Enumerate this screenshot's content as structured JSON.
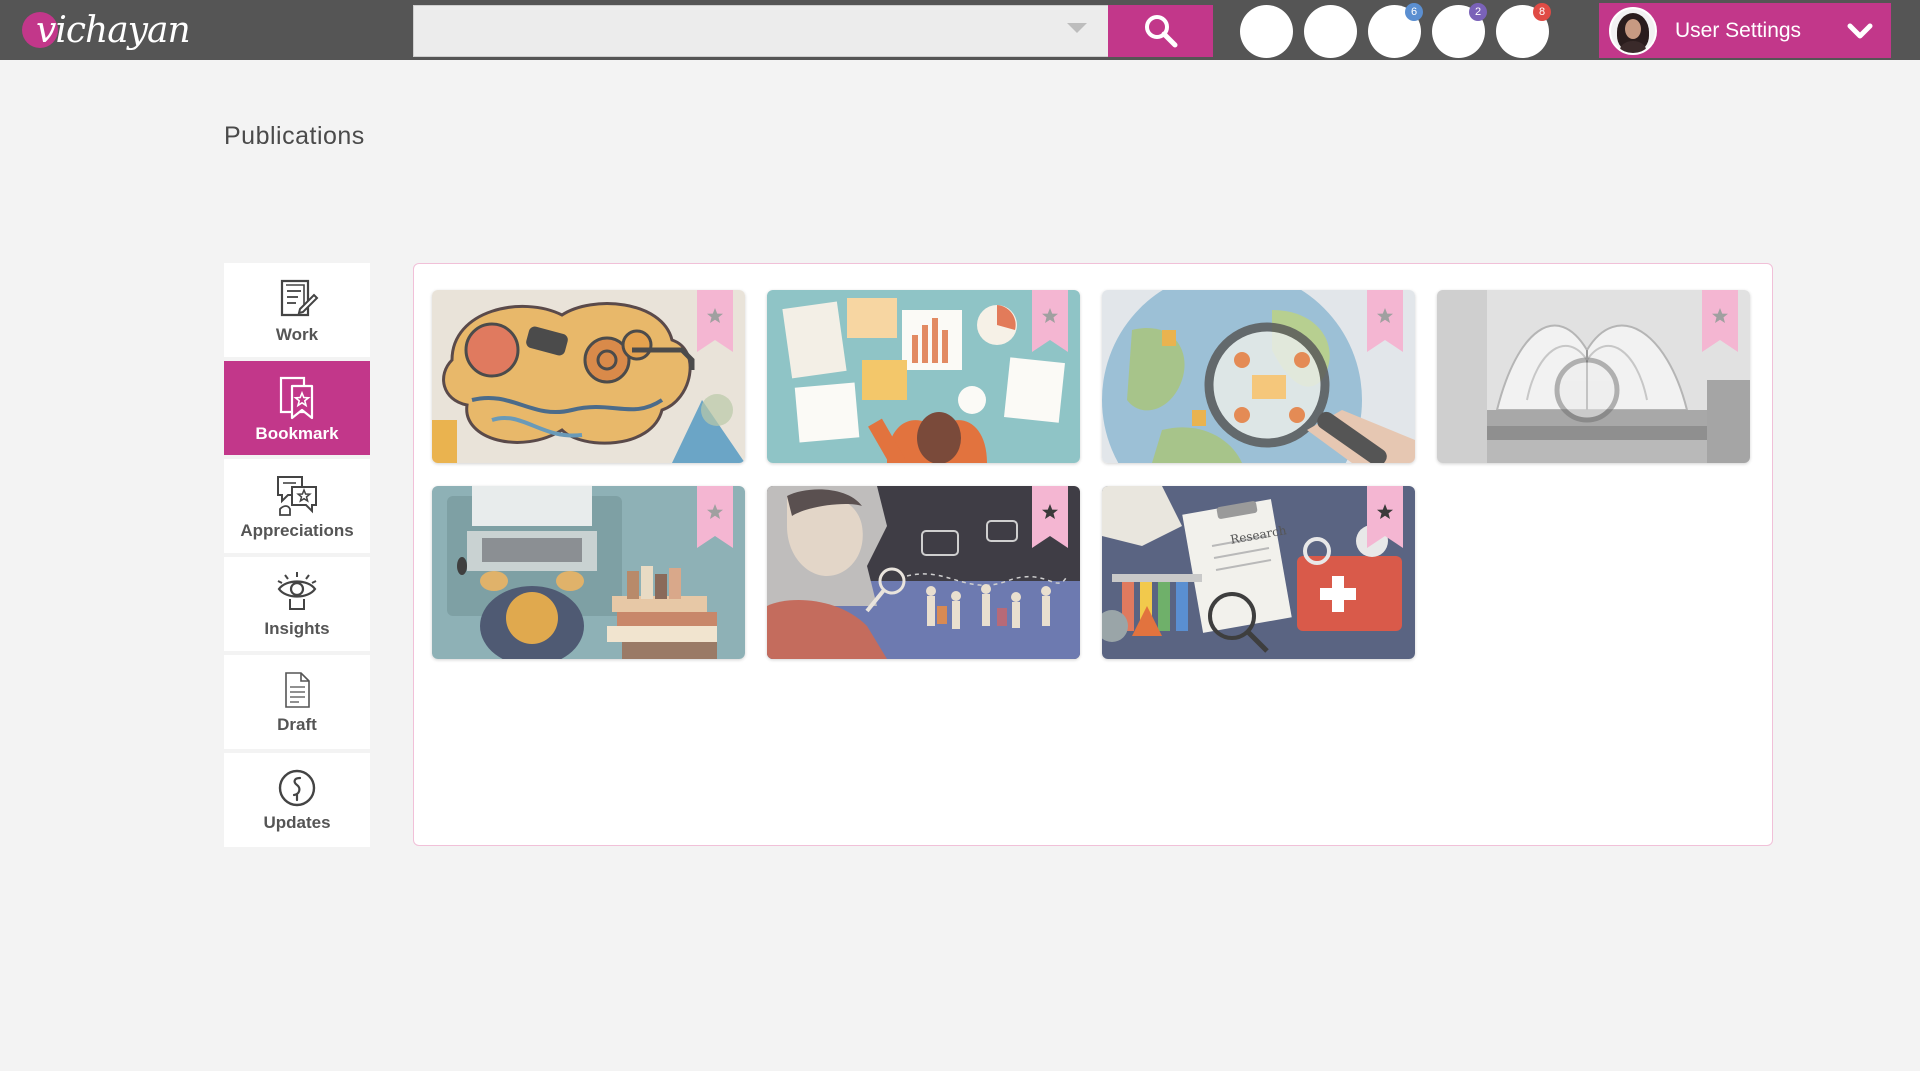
{
  "header": {
    "logo_text": "vichayan",
    "search": {
      "value": "",
      "placeholder": ""
    },
    "notification_circles": [
      {
        "badge": ""
      },
      {
        "badge": ""
      },
      {
        "badge": "6",
        "badge_color": "#5b8fd1"
      },
      {
        "badge": "2",
        "badge_color": "#7a62b8"
      },
      {
        "badge": "8",
        "badge_color": "#e04b45"
      }
    ],
    "user_settings_label": "User Settings"
  },
  "page": {
    "title": "Publications"
  },
  "sidebar": {
    "items": [
      {
        "label": "Work",
        "icon": "document-pen-icon",
        "active": false
      },
      {
        "label": "Bookmark",
        "icon": "bookmark-icon",
        "active": true
      },
      {
        "label": "Appreciations",
        "icon": "chat-star-icon",
        "active": false
      },
      {
        "label": "Insights",
        "icon": "eye-icon",
        "active": false
      },
      {
        "label": "Draft",
        "icon": "file-icon",
        "active": false
      },
      {
        "label": "Updates",
        "icon": "clock-icon",
        "active": false
      }
    ]
  },
  "publications": [
    {
      "theme": "brain-gears-illustration",
      "ribbon": "light"
    },
    {
      "theme": "desk-charts-illustration",
      "ribbon": "light"
    },
    {
      "theme": "globe-magnifier-illustration",
      "ribbon": "light"
    },
    {
      "theme": "books-magnifier-photo",
      "ribbon": "light"
    },
    {
      "theme": "laptop-books-illustration",
      "ribbon": "light"
    },
    {
      "theme": "scientist-people-illustration",
      "ribbon": "dark"
    },
    {
      "theme": "research-lab-illustration",
      "ribbon": "dark"
    }
  ],
  "research_label": "Research",
  "colors": {
    "accent": "#c2378a",
    "topbar": "#555555",
    "ribbon": "#f4b6d2",
    "panel_border": "#f1c0d8"
  }
}
